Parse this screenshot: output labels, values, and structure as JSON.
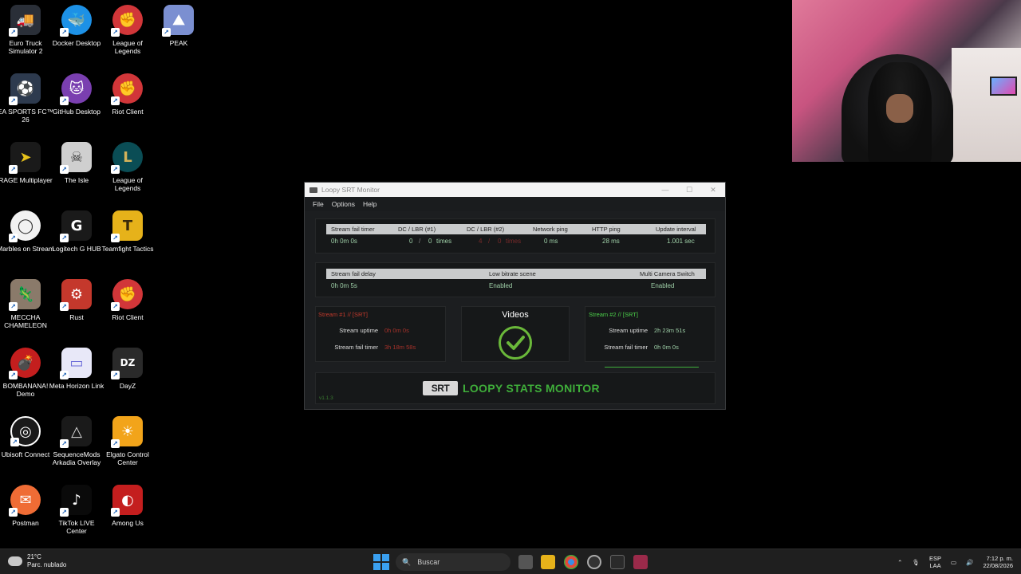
{
  "desktop": {
    "icons": [
      {
        "label": "Euro Truck Simulator 2",
        "icon": "truck-icon",
        "color": "#2a2f38"
      },
      {
        "label": "Docker Desktop",
        "icon": "docker-icon",
        "color": "#1d91e6"
      },
      {
        "label": "League of Legends",
        "icon": "riot-icon",
        "color": "#d13639"
      },
      {
        "label": "PEAK",
        "icon": "mountain-icon",
        "color": "#7b8fd1"
      },
      {
        "label": "EA SPORTS FC™ 26",
        "icon": "ea-fc-icon",
        "color": "#2d3a4e"
      },
      {
        "label": "GitHub Desktop",
        "icon": "github-icon",
        "color": "#7a3fb0"
      },
      {
        "label": "Riot Client",
        "icon": "riot-icon",
        "color": "#d13639"
      },
      {
        "label": "RAGE Multiplayer",
        "icon": "rage-icon",
        "color": "#1a1a1a"
      },
      {
        "label": "The Isle",
        "icon": "isle-icon",
        "color": "#cfcfcf"
      },
      {
        "label": "League of Legends",
        "icon": "lol-icon",
        "color": "#0a4d55"
      },
      {
        "label": "Marbles on Stream",
        "icon": "marbles-icon",
        "color": "#f2f2f2"
      },
      {
        "label": "Logitech G HUB",
        "icon": "logitech-icon",
        "color": "#1a1a1a"
      },
      {
        "label": "Teamfight Tactics",
        "icon": "tft-icon",
        "color": "#e6b21a"
      },
      {
        "label": "MECCHA CHAMELEON",
        "icon": "chameleon-icon",
        "color": "#8a7a6a"
      },
      {
        "label": "Rust",
        "icon": "rust-icon",
        "color": "#c4382c"
      },
      {
        "label": "Riot Client",
        "icon": "riot-icon",
        "color": "#d13639"
      },
      {
        "label": "BOMBANANA! Demo",
        "icon": "bombanana-icon",
        "color": "#c41e1e"
      },
      {
        "label": "Meta Horizon Link",
        "icon": "meta-icon",
        "color": "#e8e8f8"
      },
      {
        "label": "DayZ",
        "icon": "dayz-icon",
        "color": "#2a2a2a"
      },
      {
        "label": "Ubisoft Connect",
        "icon": "ubisoft-icon",
        "color": "#1a1a1a"
      },
      {
        "label": "SequenceMods Arkadia Overlay",
        "icon": "sequence-icon",
        "color": "#1a1a1a"
      },
      {
        "label": "Elgato Control Center",
        "icon": "elgato-icon",
        "color": "#f2a41a"
      },
      {
        "label": "Postman",
        "icon": "postman-icon",
        "color": "#ef6c35"
      },
      {
        "label": "TikTok LIVE Center",
        "icon": "tiktok-icon",
        "color": "#0a0a0a"
      },
      {
        "label": "Among Us",
        "icon": "among-us-icon",
        "color": "#c41e1e"
      }
    ]
  },
  "app": {
    "title": "Loopy SRT Monitor",
    "menu": [
      "File",
      "Options",
      "Help"
    ],
    "stats_headers": [
      "Stream fail timer",
      "DC  /  LBR (#1)",
      "DC  /  LBR (#2)",
      "Network ping",
      "HTTP ping",
      "Update interval"
    ],
    "stats_values": {
      "fail_timer": "0h 0m 0s",
      "dc1": "0",
      "dc1_sep": "/",
      "lbr1": "0",
      "lbr1_unit": "times",
      "dc2": "4",
      "dc2_sep": "/",
      "lbr2": "0",
      "lbr2_unit": "times",
      "network_ping": "0 ms",
      "http_ping": "28 ms",
      "update_interval": "1.001 sec"
    },
    "settings_headers": [
      "Stream fail delay",
      "Low bitrate scene",
      "Multi Camera Switch"
    ],
    "settings_values": [
      "0h 0m 5s",
      "Enabled",
      "Enabled"
    ],
    "stream1": {
      "title": "Stream #1  //  [SRT]",
      "uptime_label": "Stream uptime",
      "uptime": "0h 0m 0s",
      "fail_label": "Stream fail timer",
      "fail": "3h 18m 58s"
    },
    "scene": {
      "label": "Videos",
      "icon": "check-circle-icon"
    },
    "stream2": {
      "title": "Stream #2  //  [SRT]",
      "uptime_label": "Stream uptime",
      "uptime": "2h 23m 51s",
      "fail_label": "Stream fail timer",
      "fail": "0h 0m 0s"
    },
    "logo_srt": "SRT",
    "logo_text": "LOOPY STATS MONITOR",
    "version": "v1.1.3",
    "colors": {
      "accent_green": "#3fae3a",
      "red": "#c0392b"
    }
  },
  "taskbar": {
    "weather_temp": "21°C",
    "weather_desc": "Parc. nublado",
    "search_placeholder": "Buscar",
    "lang_top": "ESP",
    "lang_bottom": "LAA",
    "time": "7:12 p. m.",
    "date": "22/08/2026"
  }
}
